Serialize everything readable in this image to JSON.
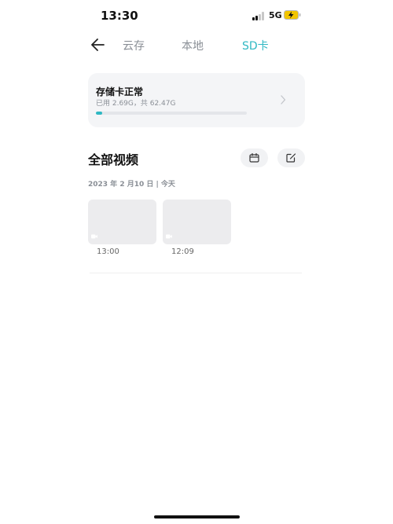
{
  "status_bar": {
    "time": "13:30",
    "network": "5G",
    "signal_icon": "cellular-signal-icon",
    "battery_icon": "battery-charging-icon",
    "colors": {
      "battery_fill": "#f2c500"
    }
  },
  "nav": {
    "back_icon": "arrow-left-icon",
    "tabs": [
      {
        "label": "云存",
        "active": false
      },
      {
        "label": "本地",
        "active": false
      },
      {
        "label": "SD卡",
        "active": true
      }
    ]
  },
  "storage": {
    "title": "存储卡正常",
    "usage_text": "已用 2.69G，共 62.47G",
    "used_fraction": 0.043,
    "chevron_icon": "chevron-right-icon"
  },
  "videos": {
    "title": "全部视频",
    "calendar_icon": "calendar-icon",
    "edit_icon": "edit-icon",
    "date_label": "2023 年 2 月10 日 | 今天",
    "items": [
      {
        "time": "13:00",
        "icon": "camera-icon"
      },
      {
        "time": "12:09",
        "icon": "camera-icon"
      }
    ]
  },
  "colors": {
    "accent": "#2fb8c3",
    "inactive_tab": "#8a8f96"
  }
}
